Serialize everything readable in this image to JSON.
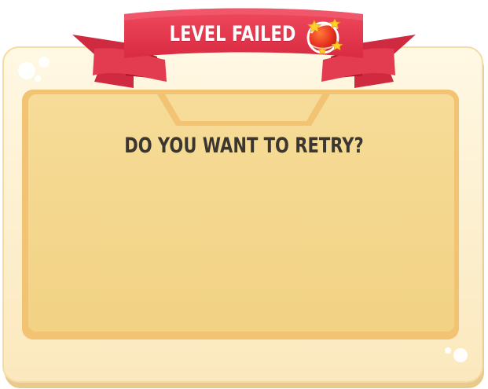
{
  "dialog": {
    "banner_title": "LEVEL FAILED",
    "message": "DO YOU WANT TO RETRY?"
  },
  "icons": {
    "badge": "stars-orb-icon"
  },
  "colors": {
    "ribbon": "#e8334a",
    "ribbon_dark": "#b41a31",
    "panel_outer": "#fdf0cc",
    "panel_inner": "#f4d68c",
    "panel_border": "#f3c374",
    "text_dark": "#3b3632"
  }
}
